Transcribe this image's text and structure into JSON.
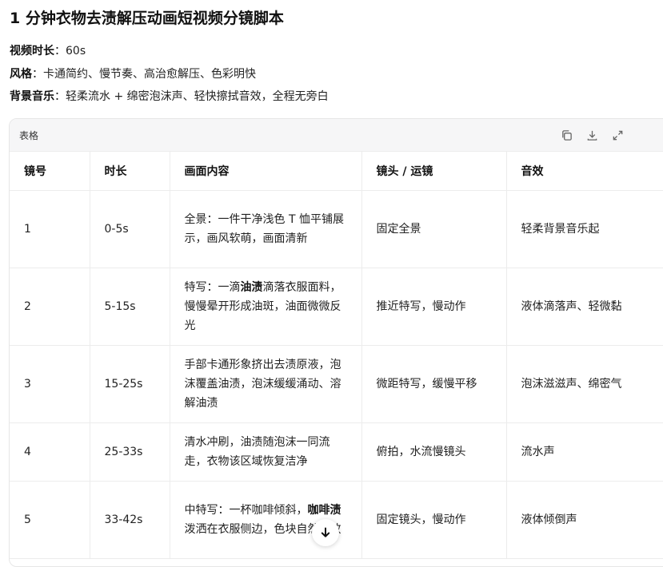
{
  "title": "1 分钟衣物去渍解压动画短视频分镜脚本",
  "meta": {
    "duration_label": "视频时长",
    "duration_value": "：60s",
    "style_label": "风格",
    "style_value": "：卡通简约、慢节奏、高治愈解压、色彩明快",
    "music_label": "背景音乐",
    "music_value": "：轻柔流水 + 绵密泡沫声、轻快擦拭音效，全程无旁白"
  },
  "card": {
    "title": "表格",
    "icons": [
      "copy-icon",
      "download-icon",
      "expand-icon"
    ]
  },
  "table": {
    "headers": [
      "镜号",
      "时长",
      "画面内容",
      "镜头 / 运镜",
      "音效"
    ],
    "rows": [
      {
        "no": "1",
        "time": "0-5s",
        "content_a": "全景：一件干净浅色 T 恤平铺展示，画风软萌，画面清新",
        "content_b": "",
        "content_c": "",
        "camera": "固定全景",
        "sound": "轻柔背景音乐起"
      },
      {
        "no": "2",
        "time": "5-15s",
        "content_a": "特写：一滴",
        "content_b": "油渍",
        "content_c": "滴落衣服面料，慢慢晕开形成油斑，油面微微反光",
        "camera": "推近特写，慢动作",
        "sound": "液体滴落声、轻微黏"
      },
      {
        "no": "3",
        "time": "15-25s",
        "content_a": "手部卡通形象挤出去渍原液，泡沫覆盖油渍，泡沫缓缓涌动、溶解油渍",
        "content_b": "",
        "content_c": "",
        "camera": "微距特写，缓慢平移",
        "sound": "泡沫滋滋声、绵密气"
      },
      {
        "no": "4",
        "time": "25-33s",
        "content_a": "清水冲刷，油渍随泡沫一同流走，衣物该区域恢复洁净",
        "content_b": "",
        "content_c": "",
        "camera": "俯拍，水流慢镜头",
        "sound": "流水声"
      },
      {
        "no": "5",
        "time": "33-42s",
        "content_a": "中特写：一杯咖啡倾斜，",
        "content_b": "咖啡渍",
        "content_c": "泼洒在衣服侧边，色块自然扩散",
        "camera": "固定镜头，慢动作",
        "sound": "液体倾倒声"
      }
    ]
  },
  "scroll_button": {
    "icon": "arrow-down-icon"
  }
}
